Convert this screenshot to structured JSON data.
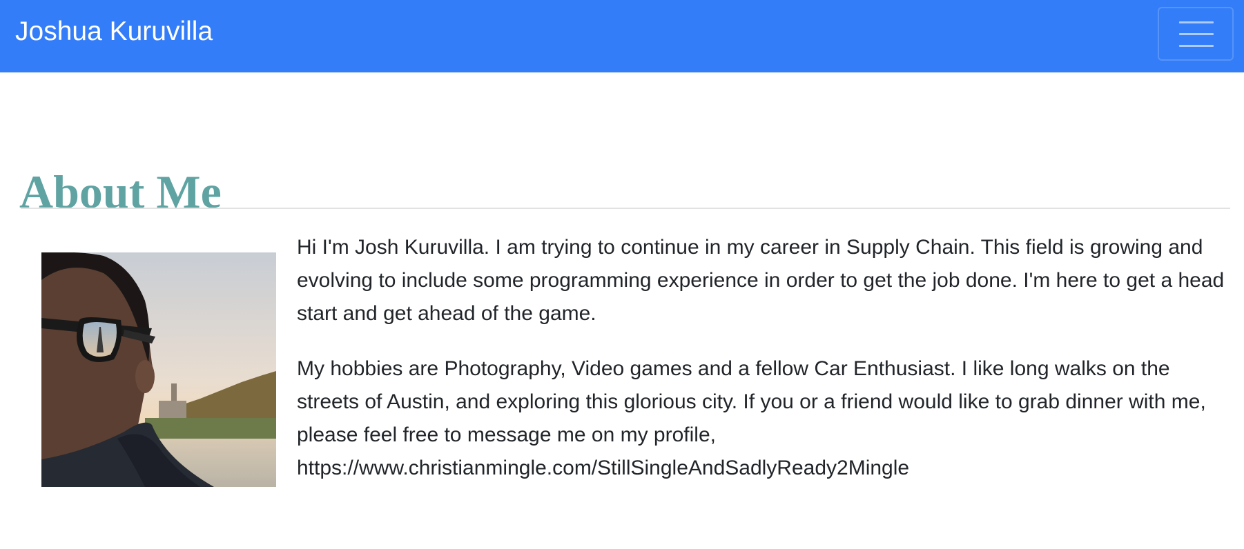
{
  "navbar": {
    "brand": "Joshua Kuruvilla",
    "toggle_icon": "hamburger-menu-icon",
    "background_color": "#337df8"
  },
  "about": {
    "heading": "About Me",
    "heading_color": "#5fa3a2",
    "photo_description": "profile-photo",
    "paragraphs": [
      "Hi I'm Josh Kuruvilla. I am trying to continue in my career in Supply Chain. This field is growing and evolving to include some programming experience in order to get the job done. I'm here to get a head start and get ahead of the game.",
      "My hobbies are Photography, Video games and a fellow Car Enthusiast. I like long walks on the streets of Austin, and exploring this glorious city. If you or a friend would like to grab dinner with me, please feel free to message me on my profile, https://www.christianmingle.com/StillSingleAndSadlyReady2Mingle"
    ]
  }
}
